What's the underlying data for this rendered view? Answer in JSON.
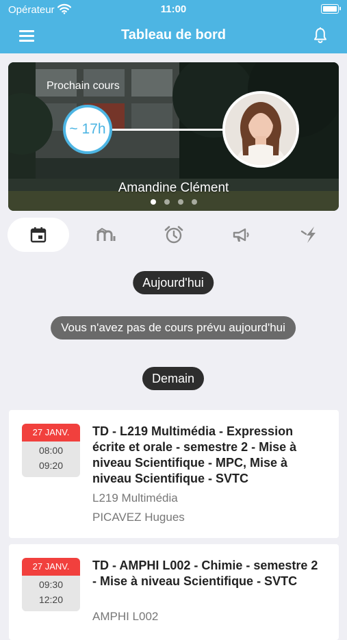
{
  "status_bar": {
    "carrier": "Opérateur",
    "time": "11:00"
  },
  "header": {
    "title": "Tableau de bord"
  },
  "hero": {
    "label": "Prochain cours",
    "time": "~ 17h",
    "teacher": "Amandine Clément",
    "slides_total": 4,
    "active_slide": 1
  },
  "tabs": [
    {
      "icon": "calendar-icon",
      "active": true
    },
    {
      "icon": "moodle-icon",
      "active": false
    },
    {
      "icon": "alarm-clock-icon",
      "active": false
    },
    {
      "icon": "megaphone-icon",
      "active": false
    },
    {
      "icon": "flash-icon",
      "active": false
    }
  ],
  "today": {
    "label": "Aujourd'hui",
    "empty_message": "Vous n'avez pas de cours prévu aujourd'hui"
  },
  "tomorrow": {
    "label": "Demain"
  },
  "courses": [
    {
      "date": "27 JANV.",
      "start": "08:00",
      "end": "09:20",
      "title": "TD - L219 Multimédia - Expression écrite et orale - semestre 2 - Mise à niveau Scientifique - MPC, Mise à niveau Scientifique - SVTC",
      "room": "L219 Multimédia",
      "teacher": "PICAVEZ Hugues"
    },
    {
      "date": "27 JANV.",
      "start": "09:30",
      "end": "12:20",
      "title": "TD - AMPHI L002 - Chimie - semestre 2 - Mise à niveau Scientifique - SVTC",
      "room": "AMPHI L002",
      "teacher": ""
    }
  ],
  "colors": {
    "primary": "#4db5e3",
    "date_header": "#f1403d",
    "background": "#efeff4",
    "pill": "#2d2d2d",
    "empty_pill": "#6a6a6a"
  }
}
